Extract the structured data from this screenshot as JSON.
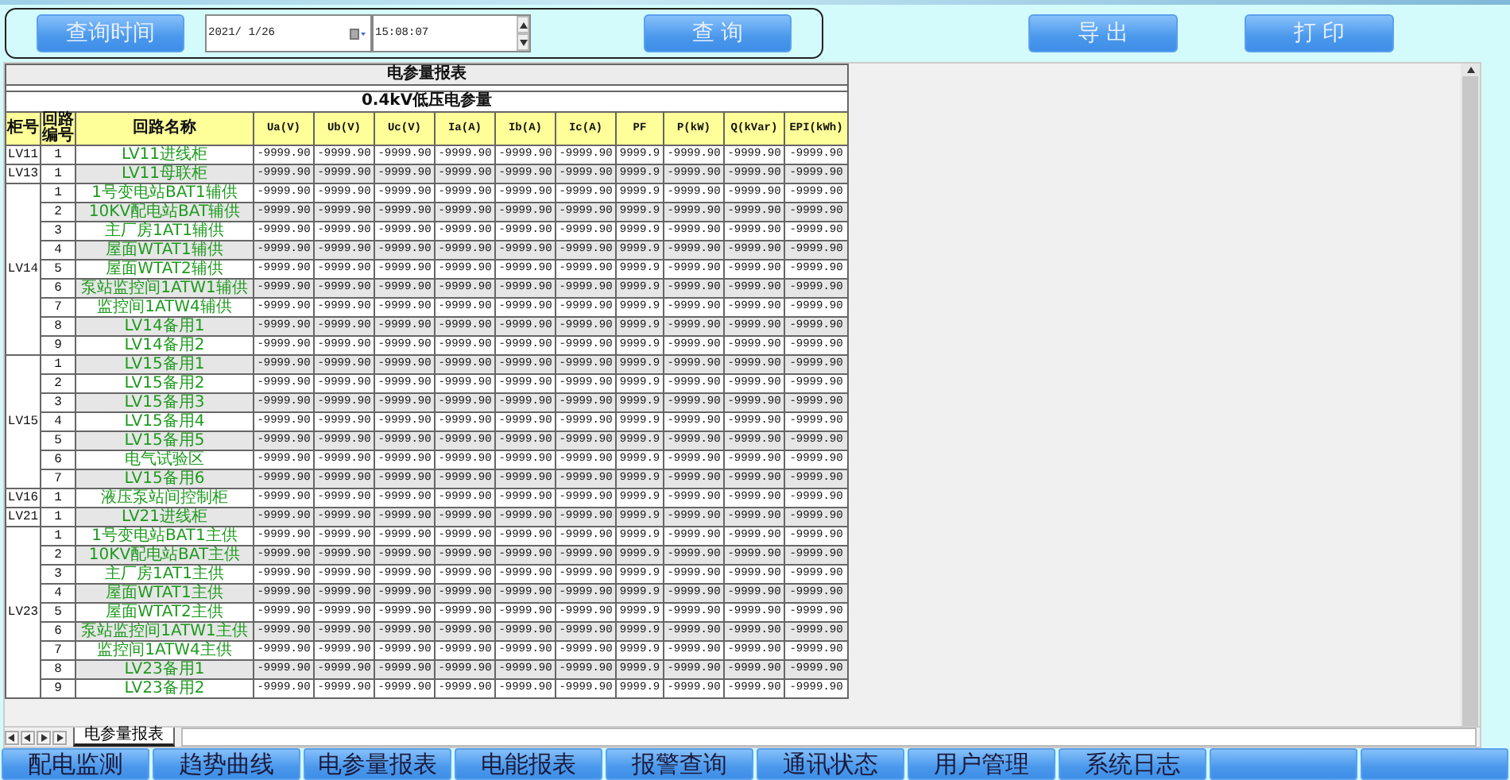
{
  "toolbar": {
    "query_time_button": "查询时间",
    "date": "2021/ 1/26",
    "time": "15:08:07",
    "query_button": "查 询"
  },
  "actions": [
    "导 出",
    "打 印"
  ],
  "report": {
    "title": "电参量报表",
    "section": "0.4kV低压电参量",
    "columns": [
      "柜号",
      "回路编号",
      "回路名称",
      "Ua(V)",
      "Ub(V)",
      "Uc(V)",
      "Ia(A)",
      "Ib(A)",
      "Ic(A)",
      "PF",
      "P(kW)",
      "Q(kVar)",
      "EPI(kWh)"
    ],
    "groups": [
      {
        "cabinet": "LV11",
        "rows": [
          {
            "no": "1",
            "name": "LV11进线柜",
            "values": [
              "-9999.90",
              "-9999.90",
              "-9999.90",
              "-9999.90",
              "-9999.90",
              "-9999.90",
              "9999.9",
              "-9999.90",
              "-9999.90",
              "-9999.90"
            ]
          }
        ]
      },
      {
        "cabinet": "LV13",
        "rows": [
          {
            "no": "1",
            "name": "LV11母联柜",
            "values": [
              "-9999.90",
              "-9999.90",
              "-9999.90",
              "-9999.90",
              "-9999.90",
              "-9999.90",
              "9999.9",
              "-9999.90",
              "-9999.90",
              "-9999.90"
            ]
          }
        ]
      },
      {
        "cabinet": "LV14",
        "rows": [
          {
            "no": "1",
            "name": "1号变电站BAT1辅供",
            "values": [
              "-9999.90",
              "-9999.90",
              "-9999.90",
              "-9999.90",
              "-9999.90",
              "-9999.90",
              "9999.9",
              "-9999.90",
              "-9999.90",
              "-9999.90"
            ]
          },
          {
            "no": "2",
            "name": "10KV配电站BAT辅供",
            "values": [
              "-9999.90",
              "-9999.90",
              "-9999.90",
              "-9999.90",
              "-9999.90",
              "-9999.90",
              "9999.9",
              "-9999.90",
              "-9999.90",
              "-9999.90"
            ]
          },
          {
            "no": "3",
            "name": "主厂房1AT1辅供",
            "values": [
              "-9999.90",
              "-9999.90",
              "-9999.90",
              "-9999.90",
              "-9999.90",
              "-9999.90",
              "9999.9",
              "-9999.90",
              "-9999.90",
              "-9999.90"
            ]
          },
          {
            "no": "4",
            "name": "屋面WTAT1辅供",
            "values": [
              "-9999.90",
              "-9999.90",
              "-9999.90",
              "-9999.90",
              "-9999.90",
              "-9999.90",
              "9999.9",
              "-9999.90",
              "-9999.90",
              "-9999.90"
            ]
          },
          {
            "no": "5",
            "name": "屋面WTAT2辅供",
            "values": [
              "-9999.90",
              "-9999.90",
              "-9999.90",
              "-9999.90",
              "-9999.90",
              "-9999.90",
              "9999.9",
              "-9999.90",
              "-9999.90",
              "-9999.90"
            ]
          },
          {
            "no": "6",
            "name": "泵站监控间1ATW1辅供",
            "values": [
              "-9999.90",
              "-9999.90",
              "-9999.90",
              "-9999.90",
              "-9999.90",
              "-9999.90",
              "9999.9",
              "-9999.90",
              "-9999.90",
              "-9999.90"
            ]
          },
          {
            "no": "7",
            "name": "监控间1ATW4辅供",
            "values": [
              "-9999.90",
              "-9999.90",
              "-9999.90",
              "-9999.90",
              "-9999.90",
              "-9999.90",
              "9999.9",
              "-9999.90",
              "-9999.90",
              "-9999.90"
            ]
          },
          {
            "no": "8",
            "name": "LV14备用1",
            "values": [
              "-9999.90",
              "-9999.90",
              "-9999.90",
              "-9999.90",
              "-9999.90",
              "-9999.90",
              "9999.9",
              "-9999.90",
              "-9999.90",
              "-9999.90"
            ]
          },
          {
            "no": "9",
            "name": "LV14备用2",
            "values": [
              "-9999.90",
              "-9999.90",
              "-9999.90",
              "-9999.90",
              "-9999.90",
              "-9999.90",
              "9999.9",
              "-9999.90",
              "-9999.90",
              "-9999.90"
            ]
          }
        ]
      },
      {
        "cabinet": "LV15",
        "rows": [
          {
            "no": "1",
            "name": "LV15备用1",
            "values": [
              "-9999.90",
              "-9999.90",
              "-9999.90",
              "-9999.90",
              "-9999.90",
              "-9999.90",
              "9999.9",
              "-9999.90",
              "-9999.90",
              "-9999.90"
            ]
          },
          {
            "no": "2",
            "name": "LV15备用2",
            "values": [
              "-9999.90",
              "-9999.90",
              "-9999.90",
              "-9999.90",
              "-9999.90",
              "-9999.90",
              "9999.9",
              "-9999.90",
              "-9999.90",
              "-9999.90"
            ]
          },
          {
            "no": "3",
            "name": "LV15备用3",
            "values": [
              "-9999.90",
              "-9999.90",
              "-9999.90",
              "-9999.90",
              "-9999.90",
              "-9999.90",
              "9999.9",
              "-9999.90",
              "-9999.90",
              "-9999.90"
            ]
          },
          {
            "no": "4",
            "name": "LV15备用4",
            "values": [
              "-9999.90",
              "-9999.90",
              "-9999.90",
              "-9999.90",
              "-9999.90",
              "-9999.90",
              "9999.9",
              "-9999.90",
              "-9999.90",
              "-9999.90"
            ]
          },
          {
            "no": "5",
            "name": "LV15备用5",
            "values": [
              "-9999.90",
              "-9999.90",
              "-9999.90",
              "-9999.90",
              "-9999.90",
              "-9999.90",
              "9999.9",
              "-9999.90",
              "-9999.90",
              "-9999.90"
            ]
          },
          {
            "no": "6",
            "name": "电气试验区",
            "values": [
              "-9999.90",
              "-9999.90",
              "-9999.90",
              "-9999.90",
              "-9999.90",
              "-9999.90",
              "9999.9",
              "-9999.90",
              "-9999.90",
              "-9999.90"
            ]
          },
          {
            "no": "7",
            "name": "LV15备用6",
            "values": [
              "-9999.90",
              "-9999.90",
              "-9999.90",
              "-9999.90",
              "-9999.90",
              "-9999.90",
              "9999.9",
              "-9999.90",
              "-9999.90",
              "-9999.90"
            ]
          }
        ]
      },
      {
        "cabinet": "LV16",
        "rows": [
          {
            "no": "1",
            "name": "液压泵站间控制柜",
            "values": [
              "-9999.90",
              "-9999.90",
              "-9999.90",
              "-9999.90",
              "-9999.90",
              "-9999.90",
              "9999.9",
              "-9999.90",
              "-9999.90",
              "-9999.90"
            ]
          }
        ]
      },
      {
        "cabinet": "LV21",
        "rows": [
          {
            "no": "1",
            "name": "LV21进线柜",
            "values": [
              "-9999.90",
              "-9999.90",
              "-9999.90",
              "-9999.90",
              "-9999.90",
              "-9999.90",
              "9999.9",
              "-9999.90",
              "-9999.90",
              "-9999.90"
            ]
          }
        ]
      },
      {
        "cabinet": "LV23",
        "rows": [
          {
            "no": "1",
            "name": "1号变电站BAT1主供",
            "values": [
              "-9999.90",
              "-9999.90",
              "-9999.90",
              "-9999.90",
              "-9999.90",
              "-9999.90",
              "9999.9",
              "-9999.90",
              "-9999.90",
              "-9999.90"
            ]
          },
          {
            "no": "2",
            "name": "10KV配电站BAT主供",
            "values": [
              "-9999.90",
              "-9999.90",
              "-9999.90",
              "-9999.90",
              "-9999.90",
              "-9999.90",
              "9999.9",
              "-9999.90",
              "-9999.90",
              "-9999.90"
            ]
          },
          {
            "no": "3",
            "name": "主厂房1AT1主供",
            "values": [
              "-9999.90",
              "-9999.90",
              "-9999.90",
              "-9999.90",
              "-9999.90",
              "-9999.90",
              "9999.9",
              "-9999.90",
              "-9999.90",
              "-9999.90"
            ]
          },
          {
            "no": "4",
            "name": "屋面WTAT1主供",
            "values": [
              "-9999.90",
              "-9999.90",
              "-9999.90",
              "-9999.90",
              "-9999.90",
              "-9999.90",
              "9999.9",
              "-9999.90",
              "-9999.90",
              "-9999.90"
            ]
          },
          {
            "no": "5",
            "name": "屋面WTAT2主供",
            "values": [
              "-9999.90",
              "-9999.90",
              "-9999.90",
              "-9999.90",
              "-9999.90",
              "-9999.90",
              "9999.9",
              "-9999.90",
              "-9999.90",
              "-9999.90"
            ]
          },
          {
            "no": "6",
            "name": "泵站监控间1ATW1主供",
            "values": [
              "-9999.90",
              "-9999.90",
              "-9999.90",
              "-9999.90",
              "-9999.90",
              "-9999.90",
              "9999.9",
              "-9999.90",
              "-9999.90",
              "-9999.90"
            ]
          },
          {
            "no": "7",
            "name": "监控间1ATW4主供",
            "values": [
              "-9999.90",
              "-9999.90",
              "-9999.90",
              "-9999.90",
              "-9999.90",
              "-9999.90",
              "9999.9",
              "-9999.90",
              "-9999.90",
              "-9999.90"
            ]
          },
          {
            "no": "8",
            "name": "LV23备用1",
            "values": [
              "-9999.90",
              "-9999.90",
              "-9999.90",
              "-9999.90",
              "-9999.90",
              "-9999.90",
              "9999.9",
              "-9999.90",
              "-9999.90",
              "-9999.90"
            ]
          },
          {
            "no": "9",
            "name": "LV23备用2",
            "values": [
              "-9999.90",
              "-9999.90",
              "-9999.90",
              "-9999.90",
              "-9999.90",
              "-9999.90",
              "9999.9",
              "-9999.90",
              "-9999.90",
              "-9999.90"
            ]
          }
        ]
      }
    ]
  },
  "sheet_tabs": [
    {
      "label": "电参量报表",
      "selected": true
    }
  ],
  "nav": [
    {
      "kind": "label",
      "label": "配电监测"
    },
    {
      "kind": "label",
      "label": "趋势曲线"
    },
    {
      "kind": "label",
      "label": "电参量报表"
    },
    {
      "kind": "label",
      "label": "电能报表"
    },
    {
      "kind": "label",
      "label": "报警查询"
    },
    {
      "kind": "label",
      "label": "通讯状态"
    },
    {
      "kind": "label",
      "label": "用户管理"
    },
    {
      "kind": "label",
      "label": "系统日志"
    },
    {
      "kind": "blank"
    },
    {
      "kind": "blank"
    }
  ]
}
